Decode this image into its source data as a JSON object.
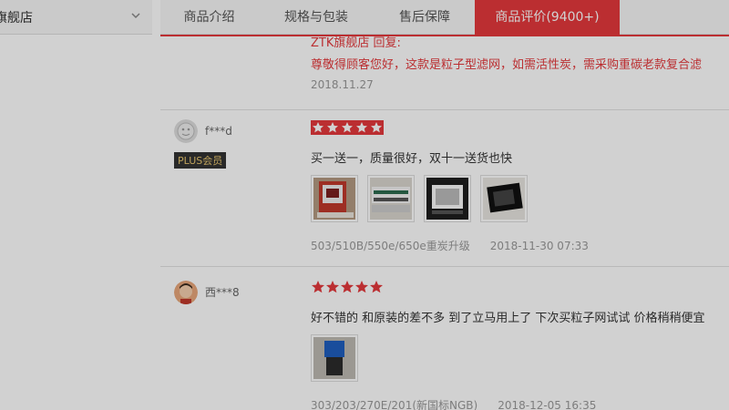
{
  "shop": {
    "name": "旗舰店",
    "chevron_icon": "chevron-down-icon"
  },
  "tabs": [
    {
      "label": "商品介绍"
    },
    {
      "label": "规格与包装"
    },
    {
      "label": "售后保障"
    },
    {
      "label": "商品评价(9400+)"
    }
  ],
  "colors": {
    "accent": "#e4393c",
    "plus_text": "#e8c66f"
  },
  "reply": {
    "header": "ZTK旗舰店 回复:",
    "body": "尊敬得顾客您好，这款是粒子型滤网，如需活性炭，需采购重碳老款复合滤",
    "date": "2018.11.27"
  },
  "reviews": [
    {
      "username": "f***d",
      "badge": "PLUS会员",
      "stars": 5,
      "content": "买一送一，质量很好，双十一送货也快",
      "images": [
        "photo-thumbnail-1",
        "photo-thumbnail-2",
        "photo-thumbnail-3",
        "photo-thumbnail-4"
      ],
      "product": "503/510B/550e/650e重炭升级",
      "time": "2018-11-30 07:33"
    },
    {
      "username": "西***8",
      "stars": 5,
      "content": "好不错的 和原装的差不多 到了立马用上了 下次买粒子网试试 价格稍稍便宜",
      "images": [
        "photo-thumbnail-1"
      ],
      "product": "303/203/270E/201(新国标NGB)",
      "time": "2018-12-05 16:35"
    }
  ]
}
